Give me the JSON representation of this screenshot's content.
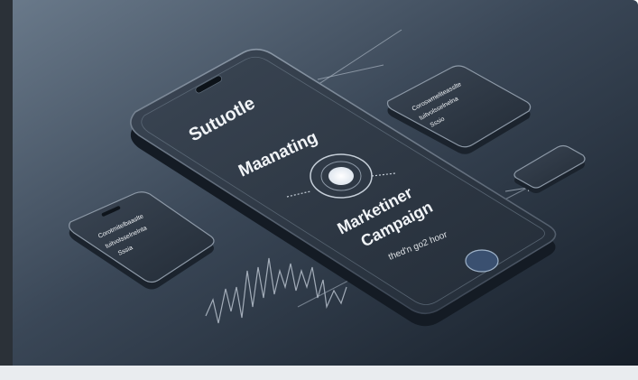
{
  "main_phone": {
    "line_1": "Sutuotle",
    "line_2": "Maanating",
    "line_3": "Marketiner",
    "line_4": "Campaign",
    "line_5": "thed'n go2 hoor"
  },
  "left_phone": {
    "line_1": "Corotmitelbaaslte",
    "line_2": "tuitvolsselnelnta",
    "line_3": "Sssia"
  },
  "right_phone": {
    "line_1": "Coroswmeliteasslte",
    "line_2": "tuitvolsselnelna",
    "line_3": "Sssio"
  },
  "colors": {
    "background_top": "#5b6b7c",
    "background_bottom": "#1a2430",
    "device_glass": "#2c3744",
    "text": "#f1f4f7"
  }
}
